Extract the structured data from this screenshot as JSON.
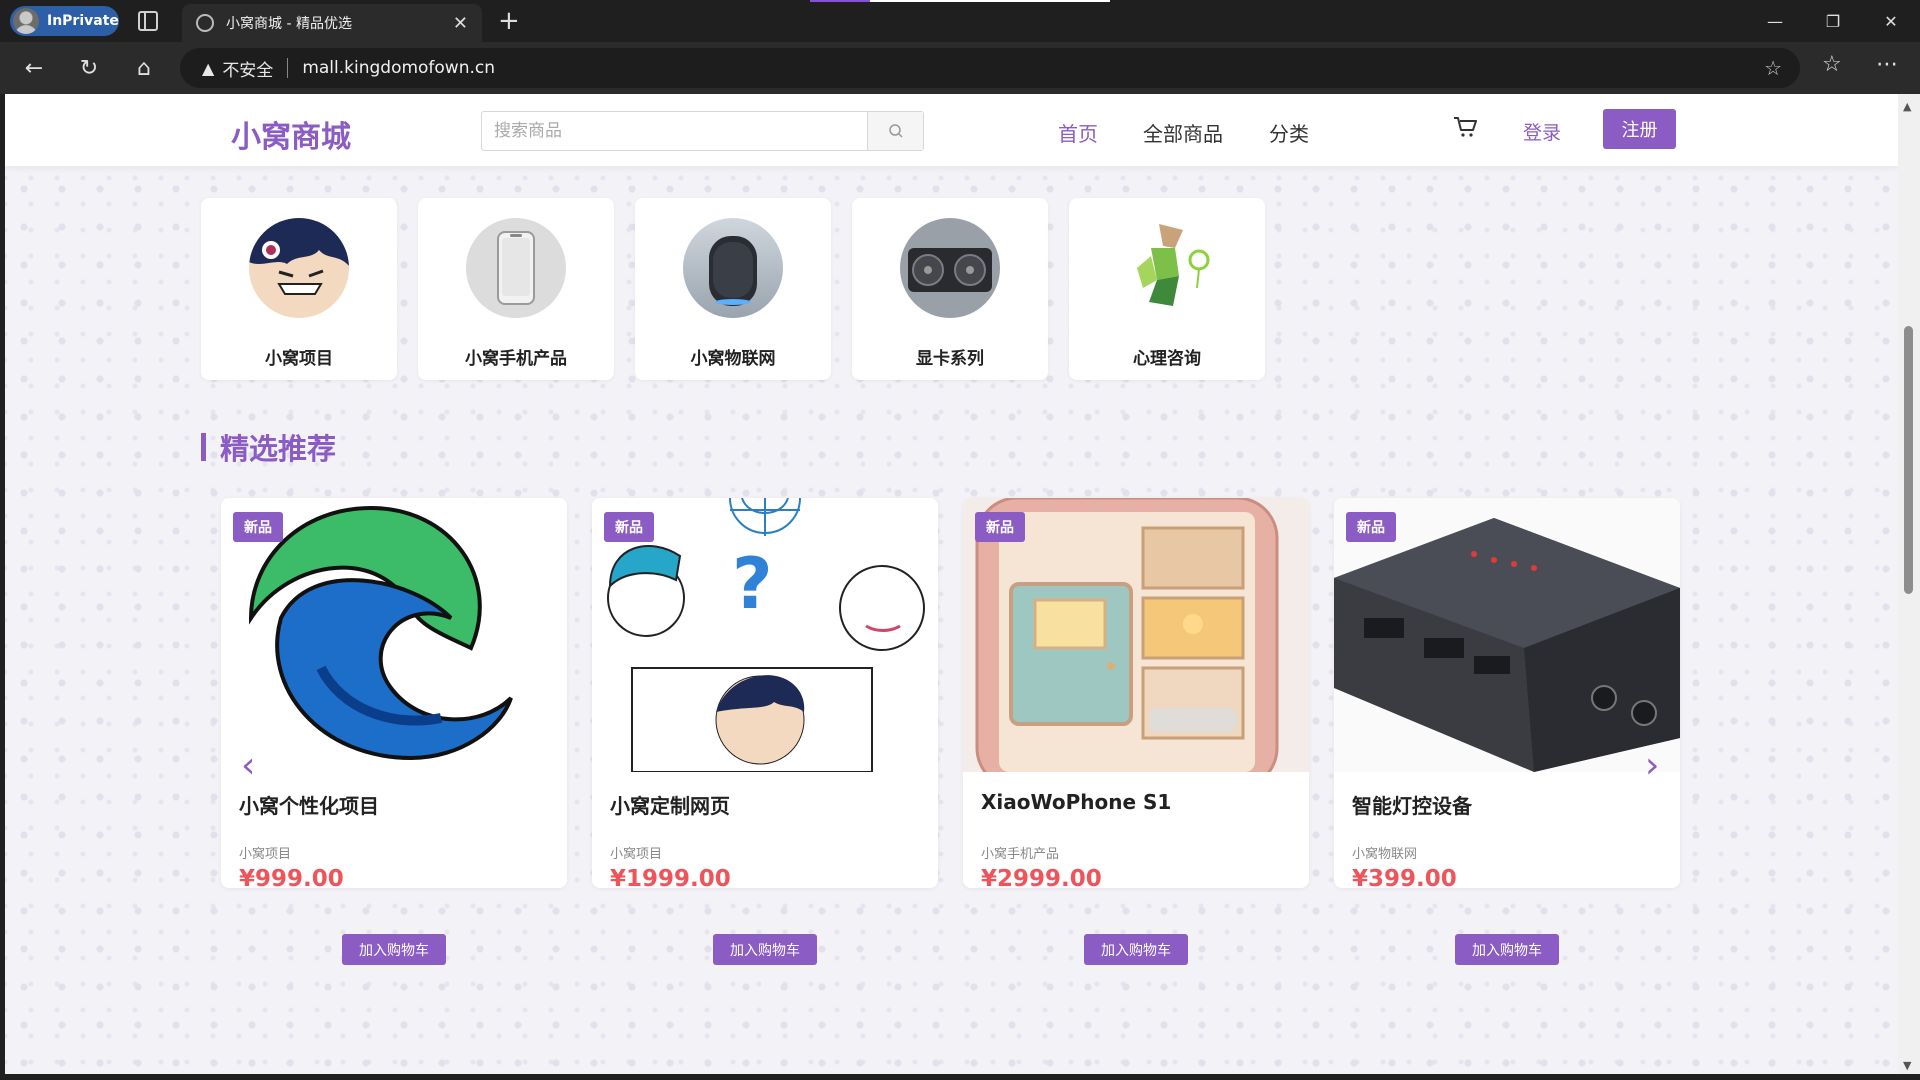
{
  "browser": {
    "profile_label": "InPrivate",
    "tab_title": "小窝商城 - 精品优选",
    "address_warning": "不安全",
    "url": "mall.kingdomofown.cn"
  },
  "header": {
    "logo": "小窝商城",
    "search_placeholder": "搜索商品",
    "nav": [
      "首页",
      "全部商品",
      "分类"
    ],
    "login": "登录",
    "register": "注册"
  },
  "categories": [
    {
      "name": "小窝项目",
      "icon": "avatar-character-icon"
    },
    {
      "name": "小窝手机产品",
      "icon": "phone-icon"
    },
    {
      "name": "小窝物联网",
      "icon": "smart-speaker-icon"
    },
    {
      "name": "显卡系列",
      "icon": "graphics-card-icon"
    },
    {
      "name": "心理咨询",
      "icon": "lowpoly-figure-icon"
    }
  ],
  "featured": {
    "title": "精选推荐",
    "badge": "新品",
    "add_to_cart": "加入购物车",
    "products": [
      {
        "name": "小窝个性化项目",
        "category": "小窝项目",
        "price": "¥999.00"
      },
      {
        "name": "小窝定制网页",
        "category": "小窝项目",
        "price": "¥1999.00"
      },
      {
        "name": "XiaoWoPhone S1",
        "category": "小窝手机产品",
        "price": "¥2999.00"
      },
      {
        "name": "智能灯控设备",
        "category": "小窝物联网",
        "price": "¥399.00"
      }
    ]
  },
  "colors": {
    "accent": "#8a5cc4",
    "price": "#f0545b"
  }
}
